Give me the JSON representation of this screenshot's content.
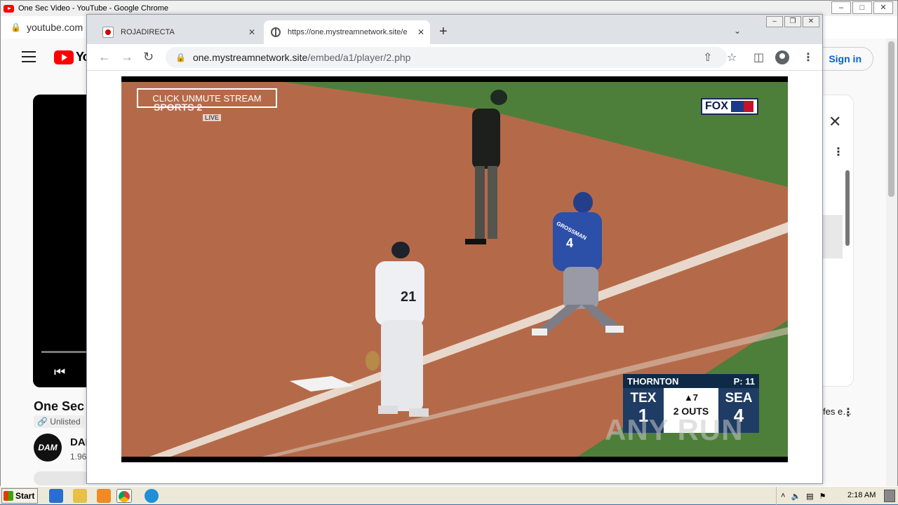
{
  "back_window": {
    "title": "One Sec Video - YouTube - Google Chrome",
    "address": "youtube.com",
    "sign_in": "Sign in",
    "video_title": "One Sec",
    "unlisted": "Unlisted",
    "avatar_text": "DAM",
    "channel": "DAI",
    "subs": "1.96",
    "side_text": "fes e…"
  },
  "front_window": {
    "tabs": [
      {
        "label": "ROJADIRECTA"
      },
      {
        "label": "https://one.mystreamnetwork.site/e"
      }
    ],
    "url_host": "one.mystreamnetwork.site",
    "url_path": "/embed/a1/player/2.php"
  },
  "video": {
    "unmute_label": "CLICK UNMUTE STREAM",
    "channel_logo": "SPORTS 2",
    "live_badge": "LIVE",
    "network_logo": "FOX",
    "pitcher": "THORNTON",
    "pitch_count": "P: 11",
    "away_team": "TEX",
    "away_runs": "1",
    "home_team": "SEA",
    "home_runs": "4",
    "inning": "▲7",
    "outs": "2 OUTS",
    "jersey_runner": "4",
    "runner_name": "GROSSMAN",
    "jersey_fielder": "21"
  },
  "watermark": "ANY RUN",
  "taskbar": {
    "start": "Start",
    "clock": "2:18 AM"
  },
  "colors": {
    "field_dirt": "#b46a48",
    "field_grass": "#4e7f3a",
    "score_dark": "#0e2a46",
    "link_blue": "#065fd4"
  }
}
